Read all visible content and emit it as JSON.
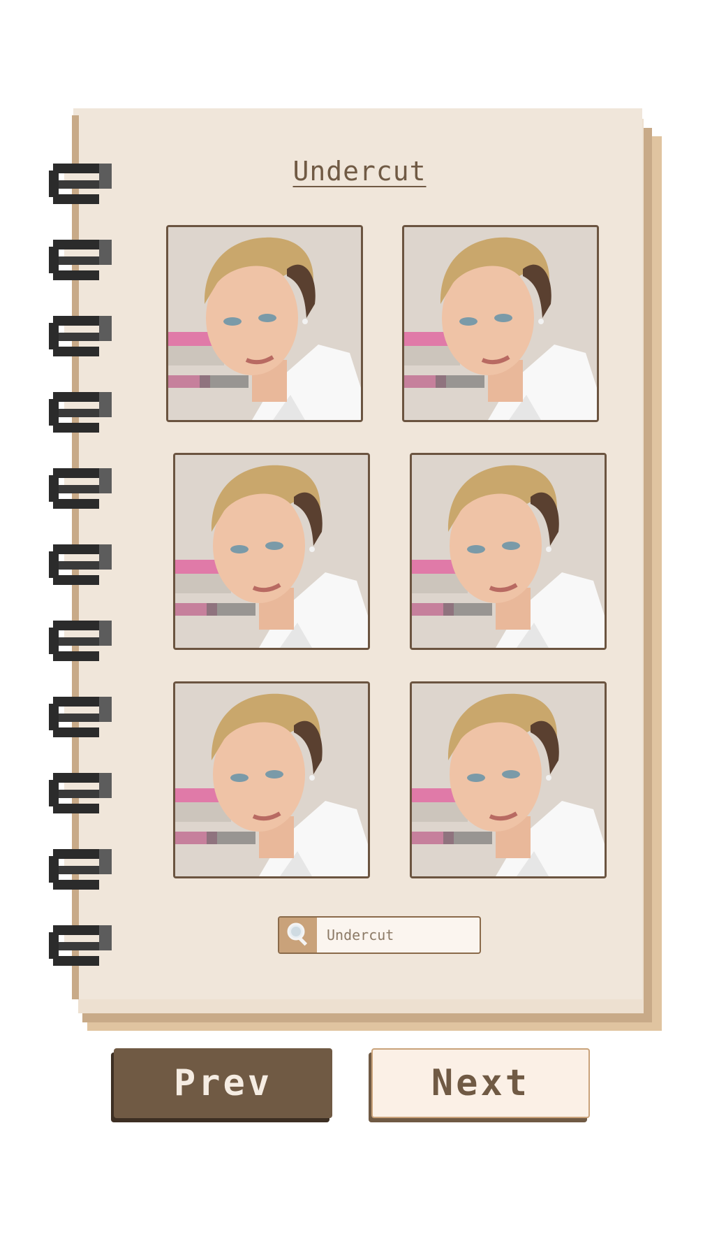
{
  "notebook": {
    "title": "Undercut",
    "ring_count": 11
  },
  "gallery": {
    "photos": [
      {
        "subject": "portrait-undercut"
      },
      {
        "subject": "portrait-undercut"
      },
      {
        "subject": "portrait-undercut"
      },
      {
        "subject": "portrait-undercut"
      },
      {
        "subject": "portrait-undercut"
      },
      {
        "subject": "portrait-undercut"
      }
    ]
  },
  "search": {
    "value": "Undercut",
    "icon": "magnifier-icon"
  },
  "nav": {
    "prev_label": "Prev",
    "next_label": "Next"
  },
  "colors": {
    "page": "#f0e6da",
    "accent_dark": "#705a44",
    "accent_light": "#c9a27a",
    "ring": "#2b2b2b"
  }
}
